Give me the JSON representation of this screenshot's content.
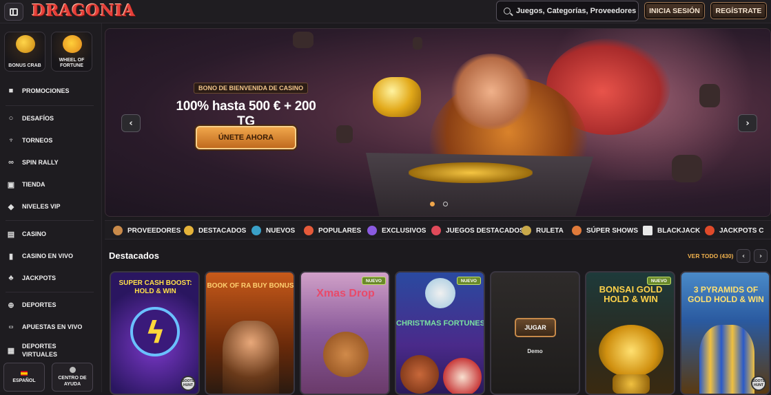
{
  "header": {
    "logo": "DRAGONIA",
    "search_placeholder": "Juegos, Categorías, Proveedores",
    "login_label": "INICIA SESIÓN",
    "register_label": "REGÍSTRATE"
  },
  "sidebar": {
    "tiles": [
      {
        "label": "BONUS CRAB",
        "icon": "crab-coin-icon"
      },
      {
        "label": "WHEEL OF FORTUNE",
        "icon": "wheel-icon"
      }
    ],
    "items": [
      {
        "label": "PROMOCIONES",
        "icon": "gift-icon"
      },
      {
        "label": "DESAFÍOS",
        "icon": "medal-icon"
      },
      {
        "label": "TORNEOS",
        "icon": "trophy-icon"
      },
      {
        "label": "SPIN RALLY",
        "icon": "rally-icon"
      },
      {
        "label": "TIENDA",
        "icon": "shop-bag-icon"
      },
      {
        "label": "NIVELES VIP",
        "icon": "diamond-icon"
      },
      {
        "label": "CASINO",
        "icon": "slot-icon"
      },
      {
        "label": "CASINO EN VIVO",
        "icon": "cards-icon"
      },
      {
        "label": "JACKPOTS",
        "icon": "clover-icon"
      },
      {
        "label": "DEPORTES",
        "icon": "ball-icon"
      },
      {
        "label": "APUESTAS EN VIVO",
        "icon": "live-icon"
      },
      {
        "label": "DEPORTES VIRTUALES",
        "icon": "virtual-icon"
      }
    ],
    "language_label": "ESPAÑOL",
    "help_label": "CENTRO DE AYUDA"
  },
  "banner": {
    "pill": "BONO DE BIENVENIDA DE CASINO",
    "title": "100% hasta 500 € + 200 TG",
    "cta": "ÚNETE AHORA",
    "prev": "‹",
    "next": "›",
    "slides_total": 2,
    "slide_active": 1
  },
  "categories": [
    {
      "label": "PROVEEDORES",
      "color": "#c98a4a"
    },
    {
      "label": "DESTACADOS",
      "color": "#e5b33a"
    },
    {
      "label": "NUEVOS",
      "color": "#3aa0c8"
    },
    {
      "label": "POPULARES",
      "color": "#e55a3a"
    },
    {
      "label": "EXCLUSIVOS",
      "color": "#8a5ae0"
    },
    {
      "label": "JUEGOS DESTACADOS",
      "color": "#e04a5a"
    },
    {
      "label": "RULETA",
      "color": "#c8a84a"
    },
    {
      "label": "SÚPER SHOWS",
      "color": "#e07a3a"
    },
    {
      "label": "BLACKJACK",
      "color": "#e8e8e8"
    },
    {
      "label": "JACKPOTS C",
      "color": "#e04a2a"
    }
  ],
  "featured": {
    "title": "Destacados",
    "see_all": "VER TODO (430)",
    "prev": "‹",
    "next": "›",
    "cards": [
      {
        "title": "SUPER CASH BOOST: HOLD & WIN",
        "is_new": false,
        "provider": "BOOTS HUNT"
      },
      {
        "title": "BOOK OF RA BUY BONUS",
        "is_new": false,
        "provider": ""
      },
      {
        "title": "Xmas Drop",
        "is_new": true,
        "provider": ""
      },
      {
        "title": "CHRISTMAS FORTUNES",
        "is_new": true,
        "provider": ""
      },
      {
        "title": "",
        "is_new": false,
        "provider": "",
        "play": "JUGAR",
        "demo": "Demo"
      },
      {
        "title": "BONSAI GOLD HOLD & WIN",
        "is_new": true,
        "provider": ""
      },
      {
        "title": "3 PYRAMIDS OF GOLD HOLD & WIN",
        "is_new": false,
        "provider": "BOOTS HUNT"
      }
    ],
    "new_badge": "NUEVO"
  },
  "colors": {
    "accent": "#f0a64b",
    "background": "#1c1a1e",
    "brand": "#e6403a"
  }
}
